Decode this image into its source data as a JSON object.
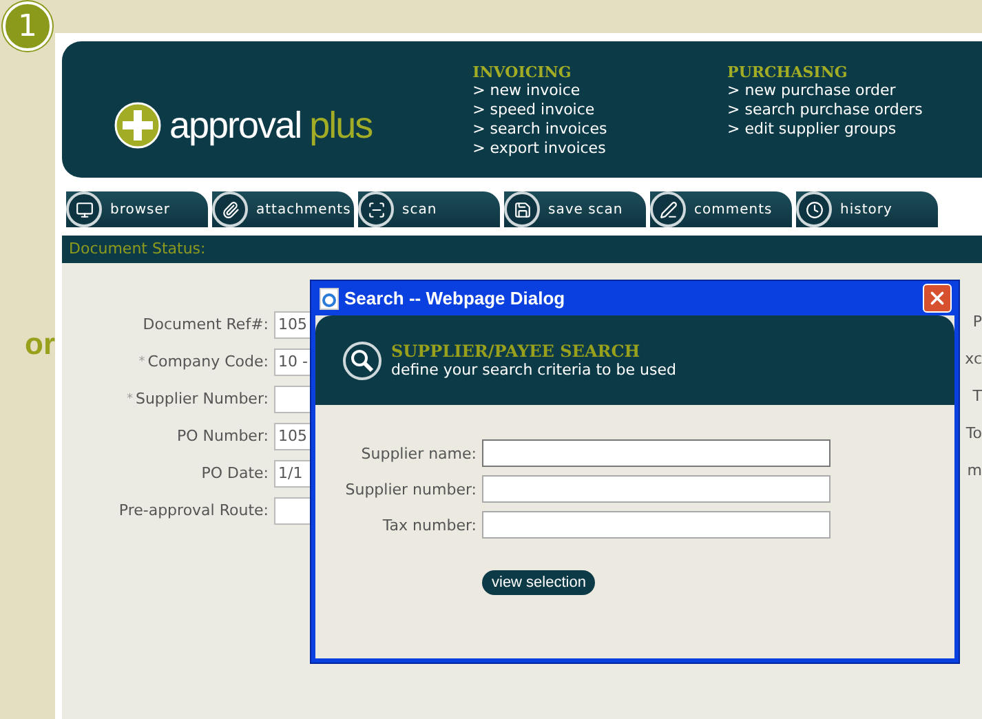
{
  "marker": "1",
  "side_text": "or",
  "brand": {
    "word1": "approval",
    "word2": "plus"
  },
  "menus": [
    {
      "title": "INVOICING",
      "items": [
        "> new invoice",
        "> speed invoice",
        "> search invoices",
        "> export invoices"
      ]
    },
    {
      "title": "PURCHASING",
      "items": [
        "> new purchase order",
        "> search purchase orders",
        "> edit supplier groups"
      ]
    }
  ],
  "toolbar": [
    {
      "label": "browser",
      "kind": "monitor"
    },
    {
      "label": "attachments",
      "kind": "clip"
    },
    {
      "label": "scan",
      "kind": "scan"
    },
    {
      "label": "save scan",
      "kind": "savescan"
    },
    {
      "label": "comments",
      "kind": "pen"
    },
    {
      "label": "history",
      "kind": "clock"
    }
  ],
  "status": {
    "label": "Document Status:"
  },
  "form": [
    {
      "label": "Document Ref#:",
      "required": false,
      "value": "105"
    },
    {
      "label": "Company Code:",
      "required": true,
      "value": "10 -"
    },
    {
      "label": "Supplier Number:",
      "required": true
    },
    {
      "label": "PO Number:",
      "required": false,
      "value": "105"
    },
    {
      "label": "PO Date:",
      "required": false,
      "value": "1/1"
    },
    {
      "label": "Pre-approval Route:",
      "required": false
    }
  ],
  "required_symbol": "*",
  "right_fragments": [
    "P",
    "xc",
    "T",
    "To",
    "m"
  ],
  "dialog": {
    "title": "Search -- Webpage Dialog",
    "heading": "SUPPLIER/PAYEE SEARCH",
    "subheading": "define your search criteria to be used",
    "fields": [
      {
        "label": "Supplier name:",
        "focused": true
      },
      {
        "label": "Supplier number:",
        "focused": false
      },
      {
        "label": "Tax number:",
        "focused": false
      }
    ],
    "button": "view selection"
  }
}
